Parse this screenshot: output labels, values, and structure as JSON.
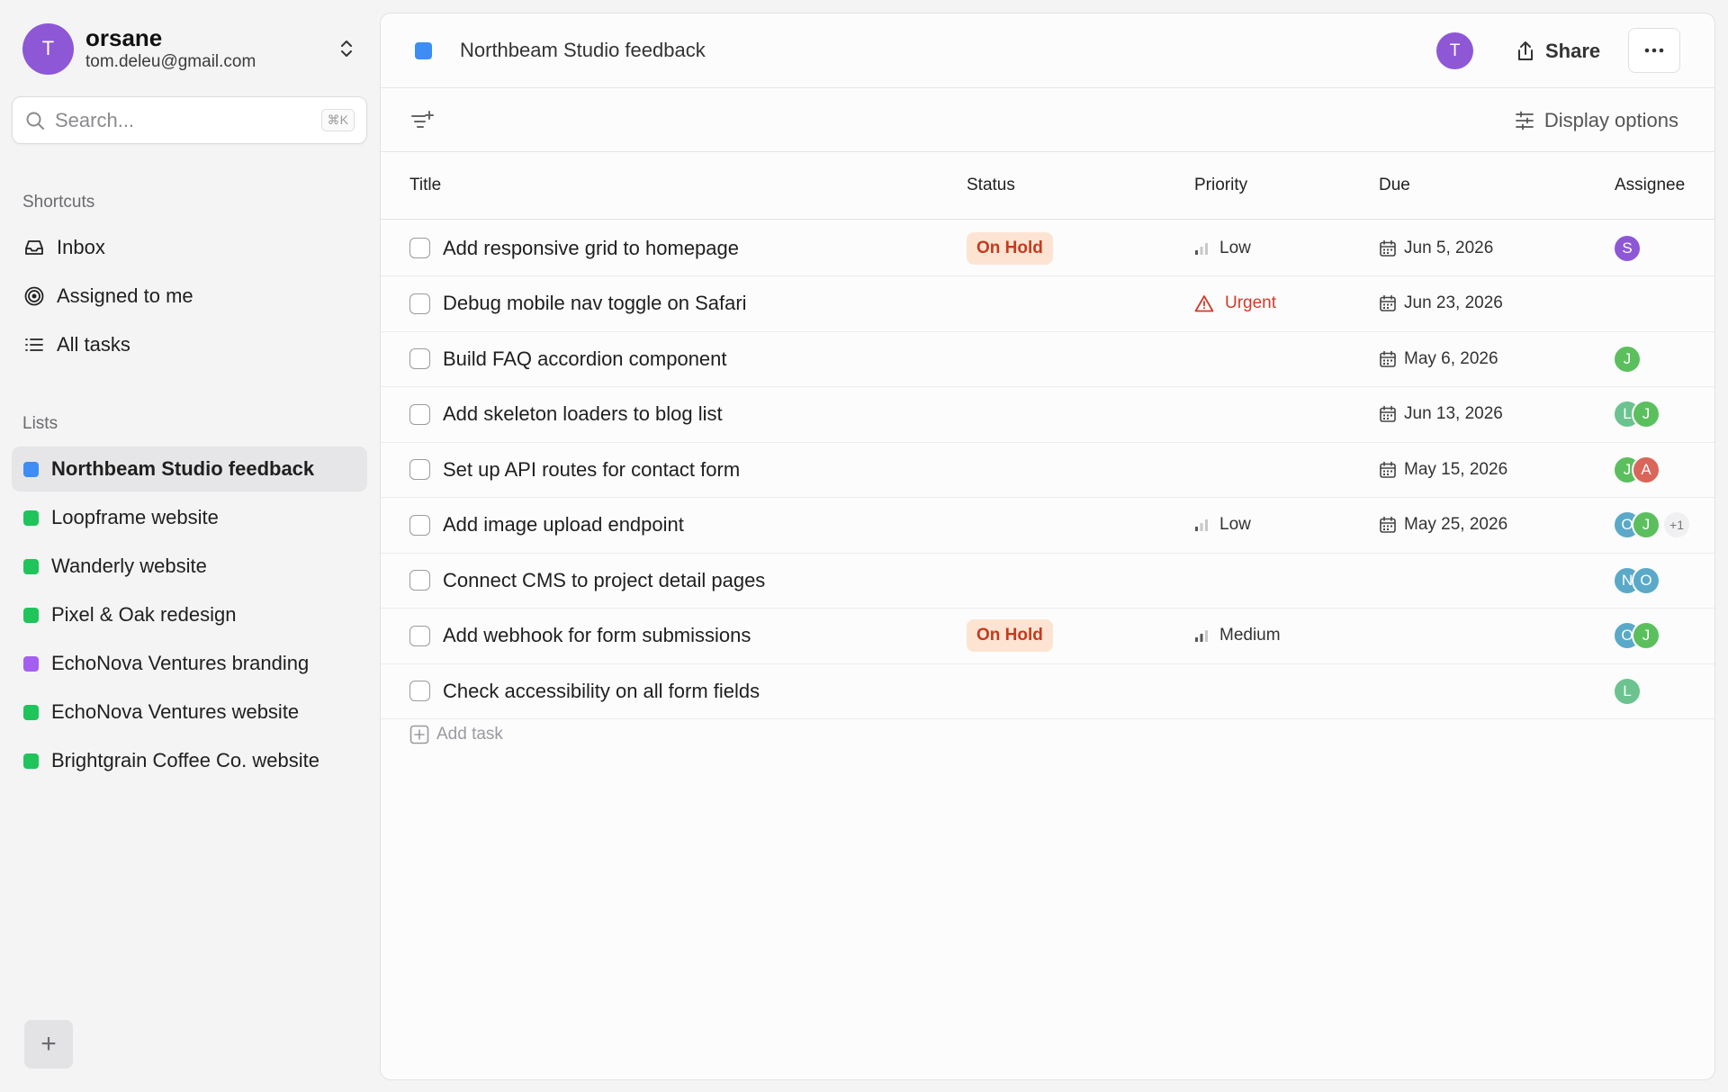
{
  "user": {
    "initial": "T",
    "name": "orsane",
    "email": "tom.deleu@gmail.com"
  },
  "search": {
    "placeholder": "Search...",
    "shortcut": "⌘K"
  },
  "shortcuts": {
    "label": "Shortcuts",
    "items": [
      {
        "label": "Inbox",
        "icon": "inbox-icon"
      },
      {
        "label": "Assigned to me",
        "icon": "target-icon"
      },
      {
        "label": "All tasks",
        "icon": "list-icon"
      }
    ]
  },
  "lists": {
    "label": "Lists",
    "items": [
      {
        "label": "Northbeam Studio feedback",
        "color": "#3d8df5",
        "active": true
      },
      {
        "label": "Loopframe website",
        "color": "#1fc55a"
      },
      {
        "label": "Wanderly website",
        "color": "#1fc55a"
      },
      {
        "label": "Pixel & Oak redesign",
        "color": "#1fc55a"
      },
      {
        "label": "EchoNova Ventures branding",
        "color": "#a55ff0"
      },
      {
        "label": "EchoNova Ventures website",
        "color": "#1fc55a"
      },
      {
        "label": "Brightgrain Coffee Co. website",
        "color": "#1fc55a"
      }
    ]
  },
  "header": {
    "title": "Northbeam Studio feedback",
    "list_color": "#3d8df5",
    "avatar_initial": "T",
    "share_label": "Share"
  },
  "toolbar": {
    "display_options_label": "Display options"
  },
  "table": {
    "columns": {
      "title": "Title",
      "status": "Status",
      "priority": "Priority",
      "due": "Due",
      "assignee": "Assignee"
    },
    "rows": [
      {
        "title": "Add responsive grid to homepage",
        "status": "On Hold",
        "priority": "Low",
        "due": "Jun 5, 2026",
        "assignees": [
          {
            "i": "S",
            "c": "#8e57d6"
          }
        ],
        "extra": ""
      },
      {
        "title": "Debug mobile nav toggle on Safari",
        "status": "",
        "priority": "Urgent",
        "due": "Jun 23, 2026",
        "assignees": [],
        "extra": ""
      },
      {
        "title": "Build FAQ accordion component",
        "status": "",
        "priority": "",
        "due": "May 6, 2026",
        "assignees": [
          {
            "i": "J",
            "c": "#5bbf5e"
          }
        ],
        "extra": ""
      },
      {
        "title": "Add skeleton loaders to blog list",
        "status": "",
        "priority": "",
        "due": "Jun 13, 2026",
        "assignees": [
          {
            "i": "L",
            "c": "#6cc390"
          },
          {
            "i": "J",
            "c": "#5bbf5e"
          }
        ],
        "extra": ""
      },
      {
        "title": "Set up API routes for contact form",
        "status": "",
        "priority": "",
        "due": "May 15, 2026",
        "assignees": [
          {
            "i": "J",
            "c": "#5bbf5e"
          },
          {
            "i": "A",
            "c": "#d9665a"
          }
        ],
        "extra": ""
      },
      {
        "title": "Add image upload endpoint",
        "status": "",
        "priority": "Low",
        "due": "May 25, 2026",
        "assignees": [
          {
            "i": "O",
            "c": "#5aa9c9"
          },
          {
            "i": "J",
            "c": "#5bbf5e"
          }
        ],
        "extra": "+1"
      },
      {
        "title": "Connect CMS to project detail pages",
        "status": "",
        "priority": "",
        "due": "",
        "assignees": [
          {
            "i": "N",
            "c": "#5aa9c9"
          },
          {
            "i": "O",
            "c": "#5aa9c9"
          }
        ],
        "extra": ""
      },
      {
        "title": "Add webhook for form submissions",
        "status": "On Hold",
        "priority": "Medium",
        "due": "",
        "assignees": [
          {
            "i": "O",
            "c": "#5aa9c9"
          },
          {
            "i": "J",
            "c": "#5bbf5e"
          }
        ],
        "extra": ""
      },
      {
        "title": "Check accessibility on all form fields",
        "status": "",
        "priority": "",
        "due": "",
        "assignees": [
          {
            "i": "L",
            "c": "#6cc390"
          }
        ],
        "extra": ""
      }
    ],
    "add_task_label": "Add task"
  },
  "footer": {
    "add_button_label": "+"
  }
}
